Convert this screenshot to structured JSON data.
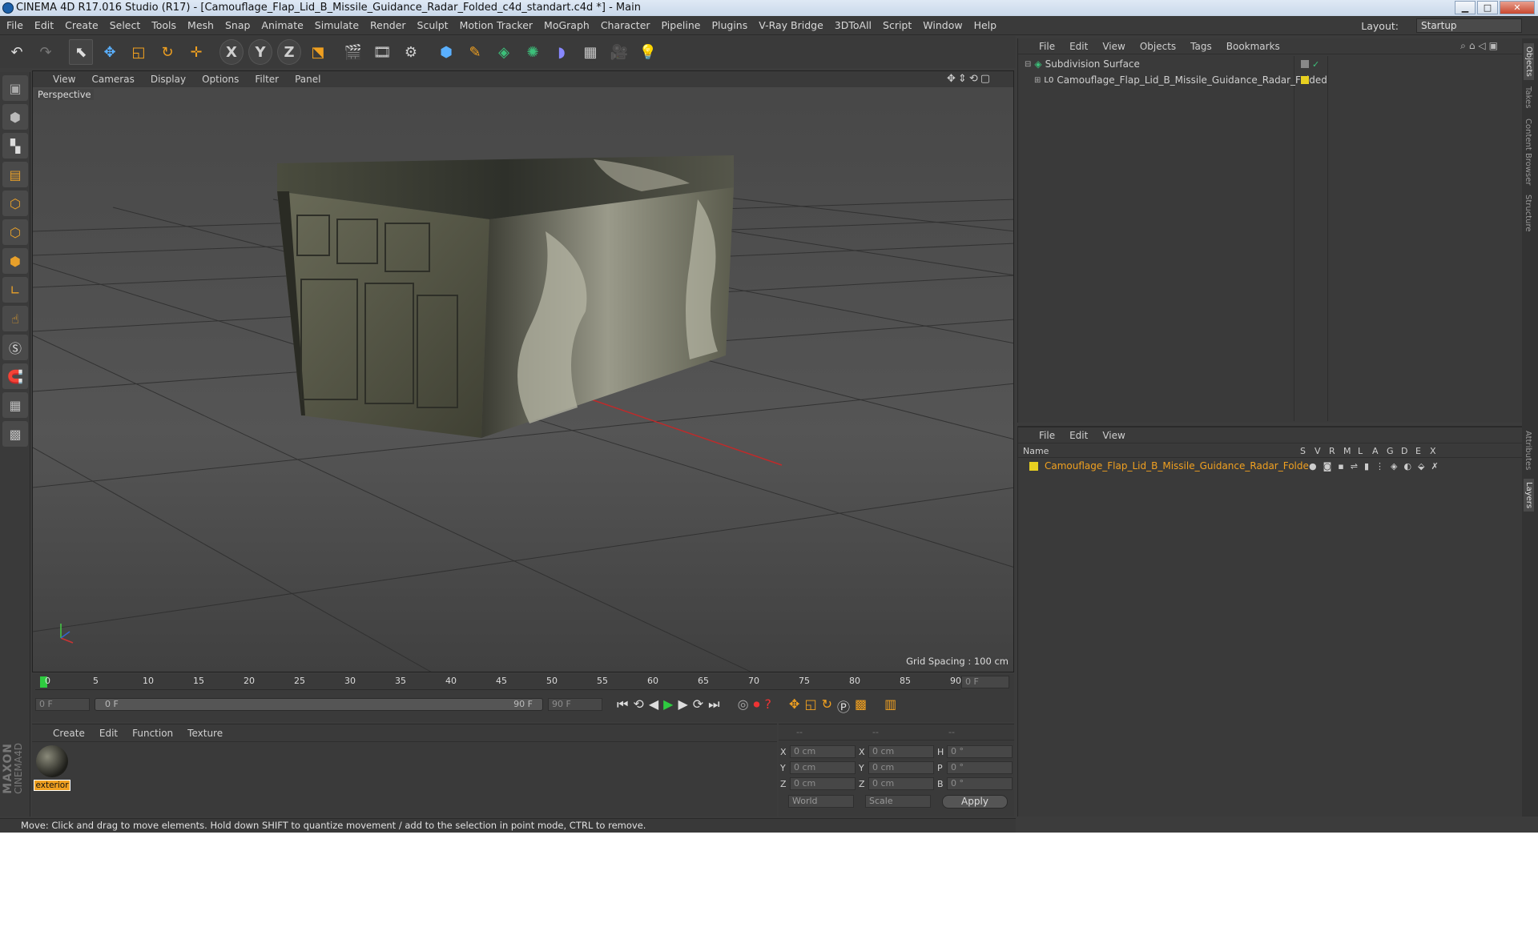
{
  "window": {
    "title": "CINEMA 4D R17.016 Studio (R17) - [Camouflage_Flap_Lid_B_Missile_Guidance_Radar_Folded_c4d_standart.c4d *] - Main",
    "minimize": "▁",
    "maximize": "□",
    "close": "✕"
  },
  "menu": [
    "File",
    "Edit",
    "Create",
    "Select",
    "Tools",
    "Mesh",
    "Snap",
    "Animate",
    "Simulate",
    "Render",
    "Sculpt",
    "Motion Tracker",
    "MoGraph",
    "Character",
    "Pipeline",
    "Plugins",
    "V-Ray Bridge",
    "3DToAll",
    "Script",
    "Window",
    "Help"
  ],
  "layout": {
    "label": "Layout:",
    "value": "Startup"
  },
  "toolbar": {
    "undo": "↶",
    "redo": "↷",
    "x": "X",
    "y": "Y",
    "z": "Z"
  },
  "viewport": {
    "menu": [
      "View",
      "Cameras",
      "Display",
      "Options",
      "Filter",
      "Panel"
    ],
    "label": "Perspective",
    "grid_spacing": "Grid Spacing : 100 cm"
  },
  "timeline": {
    "ticks": [
      "0",
      "5",
      "10",
      "15",
      "20",
      "25",
      "30",
      "35",
      "40",
      "45",
      "50",
      "55",
      "60",
      "65",
      "70",
      "75",
      "80",
      "85",
      "90"
    ],
    "current_frame": "0 F",
    "start": "0 F",
    "range_start": "0 F",
    "range_end": "90 F",
    "end": "90 F"
  },
  "materials": {
    "menu": [
      "Create",
      "Edit",
      "Function",
      "Texture"
    ],
    "items": [
      {
        "name": "exterior"
      }
    ]
  },
  "coords": {
    "headers": [
      "--",
      "--",
      "--"
    ],
    "rows": [
      {
        "a": "X",
        "av": "0 cm",
        "b": "X",
        "bv": "0 cm",
        "c": "H",
        "cv": "0 °"
      },
      {
        "a": "Y",
        "av": "0 cm",
        "b": "Y",
        "bv": "0 cm",
        "c": "P",
        "cv": "0 °"
      },
      {
        "a": "Z",
        "av": "0 cm",
        "b": "Z",
        "bv": "0 cm",
        "c": "B",
        "cv": "0 °"
      }
    ],
    "mode": "World",
    "type": "Scale",
    "apply": "Apply"
  },
  "objects": {
    "menu": [
      "File",
      "Edit",
      "View",
      "Objects",
      "Tags",
      "Bookmarks"
    ],
    "items": [
      {
        "name": "Subdivision Surface"
      },
      {
        "name": "Camouflage_Flap_Lid_B_Missile_Guidance_Radar_Folded"
      }
    ]
  },
  "layers": {
    "menu": [
      "File",
      "Edit",
      "View"
    ],
    "name_header": "Name",
    "col_headers": [
      "S",
      "V",
      "R",
      "M",
      "L",
      "A",
      "G",
      "D",
      "E",
      "X"
    ],
    "items": [
      {
        "name": "Camouflage_Flap_Lid_B_Missile_Guidance_Radar_Foldedr"
      }
    ]
  },
  "right_tabs": [
    "Objects",
    "Takes",
    "Content Browser",
    "Structure",
    "Attributes",
    "Layers"
  ],
  "status": "Move: Click and drag to move elements. Hold down SHIFT to quantize movement / add to the selection in point mode, CTRL to remove.",
  "brand": {
    "maxon": "MAXON",
    "product": "CINEMA4D"
  },
  "colors": {
    "accent": "#f0a020",
    "layer_text": "#f0a020",
    "selection": "#ffb000"
  }
}
